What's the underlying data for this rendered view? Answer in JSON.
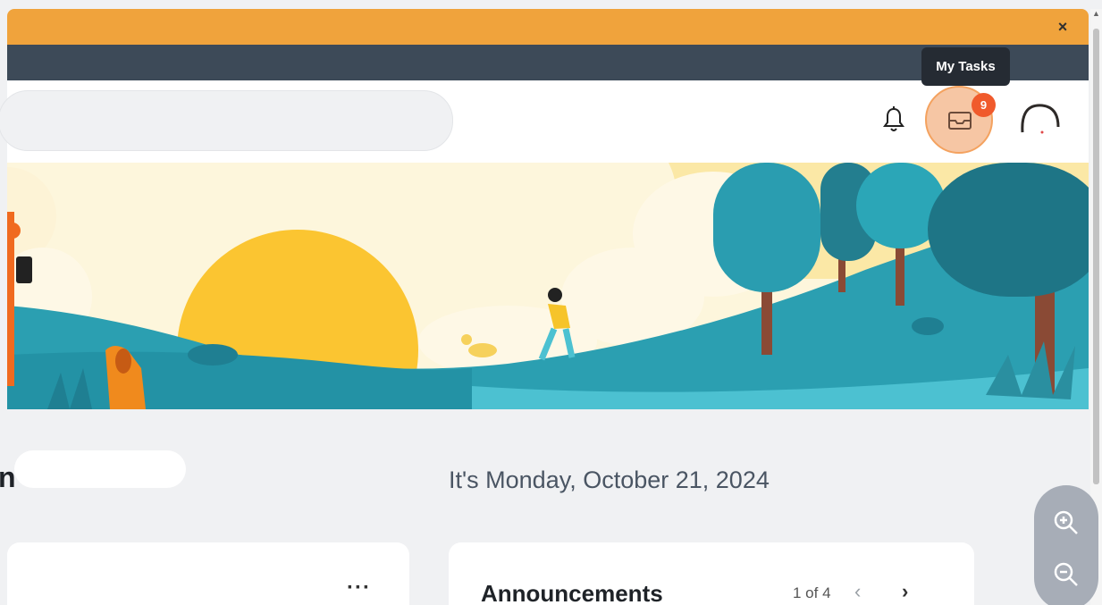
{
  "banner": {
    "close_label": "×",
    "color": "#f0a33c"
  },
  "header": {
    "search_placeholder": "",
    "notifications_icon": "bell-icon",
    "tasks_icon": "inbox-tray-icon",
    "tasks_badge": "9",
    "tasks_tooltip": "My Tasks"
  },
  "greeting": {
    "text": "n",
    "date": "It's Monday, October 21, 2024"
  },
  "cards": {
    "left": {
      "menu_label": "···"
    },
    "announcements": {
      "title": "Announcements",
      "pager": "1 of 4",
      "prev_label": "‹",
      "next_label": "›"
    }
  },
  "zoom": {
    "in_icon": "zoom-in-icon",
    "out_icon": "zoom-out-icon"
  },
  "colors": {
    "accent": "#f05a2c",
    "dark_bar": "#3d4a58",
    "teal": "#2a9db0",
    "sun": "#fbc531"
  }
}
